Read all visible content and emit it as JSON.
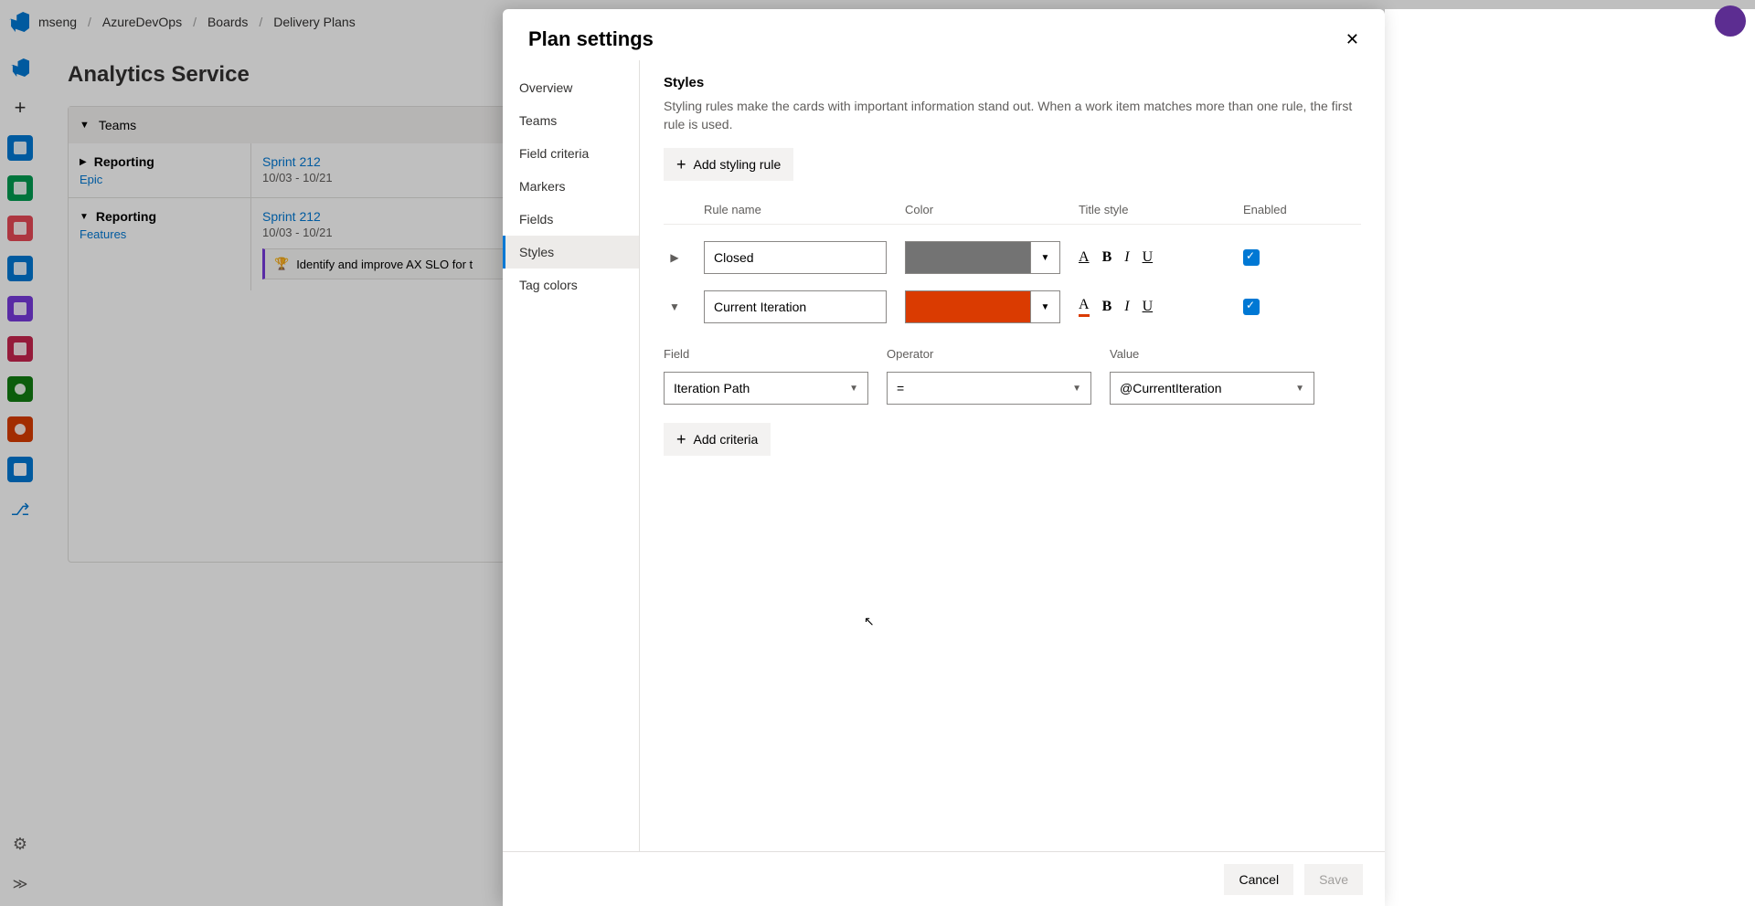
{
  "breadcrumb": {
    "org": "mseng",
    "project": "AzureDevOps",
    "area": "Boards",
    "page": "Delivery Plans"
  },
  "page_title": "Analytics Service",
  "plan": {
    "teams_label": "Teams",
    "groups": [
      {
        "team": "Reporting",
        "sub": "Epic",
        "sprint": "Sprint 212",
        "dates": "10/03 - 10/21",
        "cards": []
      },
      {
        "team": "Reporting",
        "sub": "Features",
        "sprint": "Sprint 212",
        "dates": "10/03 - 10/21",
        "cards": [
          {
            "title": "Identify and improve AX SLO for t"
          }
        ]
      }
    ]
  },
  "panel": {
    "title": "Plan settings",
    "nav": [
      "Overview",
      "Teams",
      "Field criteria",
      "Markers",
      "Fields",
      "Styles",
      "Tag colors"
    ],
    "active_nav": "Styles",
    "section_title": "Styles",
    "desc": "Styling rules make the cards with important information stand out. When a work item matches more than one rule, the first rule is used.",
    "add_rule": "Add styling rule",
    "headers": {
      "name": "Rule name",
      "color": "Color",
      "style": "Title style",
      "enabled": "Enabled"
    },
    "rules": [
      {
        "name": "Closed",
        "color": "#737373",
        "expanded": false,
        "enabled": true
      },
      {
        "name": "Current Iteration",
        "color": "#da3b01",
        "expanded": true,
        "enabled": true,
        "criteria_headers": {
          "field": "Field",
          "operator": "Operator",
          "value": "Value"
        },
        "criteria": [
          {
            "field": "Iteration Path",
            "operator": "=",
            "value": "@CurrentIteration"
          }
        ],
        "add_criteria": "Add criteria"
      }
    ],
    "footer": {
      "cancel": "Cancel",
      "save": "Save"
    }
  }
}
